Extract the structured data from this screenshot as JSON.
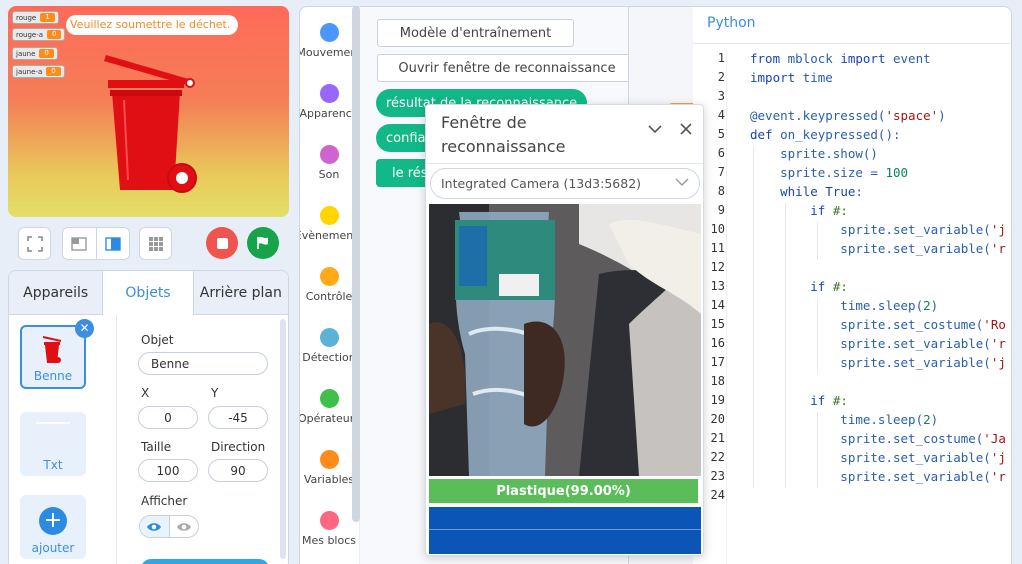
{
  "stage": {
    "variables": [
      {
        "name": "rouge",
        "value": "1"
      },
      {
        "name": "rouge-a",
        "value": "0"
      },
      {
        "name": "jaune",
        "value": "0"
      },
      {
        "name": "jaune-a",
        "value": "0"
      }
    ],
    "speech": "Veuillez soumettre le déchet."
  },
  "sprite_panel": {
    "tabs": [
      "Appareils",
      "Objets",
      "Arrière plan"
    ],
    "active_tab": "Objets",
    "sprites": [
      {
        "name": "Benne",
        "selected": true
      },
      {
        "name": "Txt",
        "selected": false
      }
    ],
    "add_label": "ajouter",
    "props": {
      "object_label": "Objet",
      "object_value": "Benne",
      "x_label": "X",
      "x_value": "0",
      "y_label": "Y",
      "y_value": "-45",
      "size_label": "Taille",
      "size_value": "100",
      "direction_label": "Direction",
      "direction_value": "90",
      "show_label": "Afficher"
    }
  },
  "palette": {
    "categories": [
      {
        "label": "Mouvement",
        "color": "#4c97ff"
      },
      {
        "label": "Apparence",
        "color": "#9966ff"
      },
      {
        "label": "Son",
        "color": "#cf63cf"
      },
      {
        "label": "Évènements",
        "color": "#ffd500"
      },
      {
        "label": "Contrôle",
        "color": "#ffab19"
      },
      {
        "label": "Détection",
        "color": "#5cb1d6"
      },
      {
        "label": "Opérateurs",
        "color": "#40bf4a"
      },
      {
        "label": "Variables",
        "color": "#ff8c1a"
      },
      {
        "label": "Mes blocs",
        "color": "#ff6680"
      }
    ]
  },
  "blocks": {
    "buttons": [
      "Modèle d'entraînement",
      "Ouvrir fenêtre de reconnaissance"
    ],
    "reporters": [
      "résultat de la reconnaissance",
      "confiance",
      "le résultat"
    ]
  },
  "code": {
    "tab": "Python",
    "lines": [
      "from mblock import event",
      "import time",
      "",
      "@event.keypressed('space')",
      "def on_keypressed():",
      "    sprite.show()",
      "    sprite.size = 100",
      "    while True:",
      "        if #:",
      "            sprite.set_variable('j",
      "            sprite.set_variable('r",
      "",
      "        if #:",
      "            time.sleep(2)",
      "            sprite.set_costume('Ro",
      "            sprite.set_variable('r",
      "            sprite.set_variable('j",
      "",
      "        if #:",
      "            time.sleep(2)",
      "            sprite.set_costume('Ja",
      "            sprite.set_variable('j",
      "            sprite.set_variable('r",
      ""
    ]
  },
  "popup": {
    "title": "Fenêtre de reconnaissance",
    "camera": "Integrated Camera (13d3:5682)",
    "result": "Plastique(99.00%)"
  }
}
